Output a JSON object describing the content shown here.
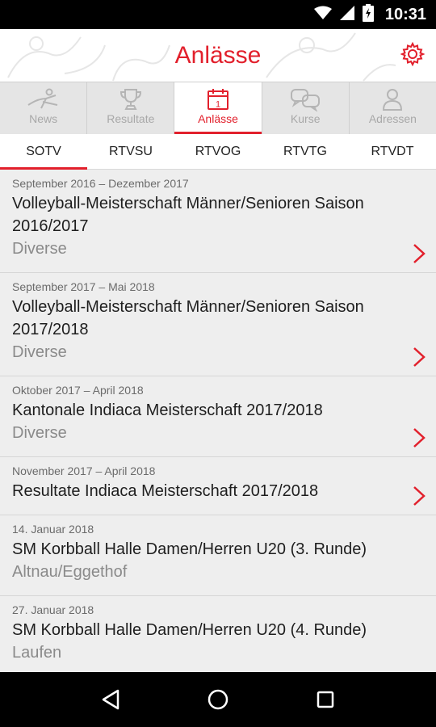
{
  "status_bar": {
    "time": "10:31",
    "icons": [
      "wifi-icon",
      "signal-icon",
      "battery-icon"
    ]
  },
  "app_bar": {
    "title": "Anlässe",
    "settings_icon": "gear-icon"
  },
  "top_tabs": [
    {
      "label": "News",
      "icon": "athlete-icon",
      "active": false
    },
    {
      "label": "Resultate",
      "icon": "trophy-icon",
      "active": false
    },
    {
      "label": "Anlässe",
      "icon": "calendar-icon",
      "active": true
    },
    {
      "label": "Kurse",
      "icon": "chat-icon",
      "active": false
    },
    {
      "label": "Adressen",
      "icon": "person-icon",
      "active": false
    }
  ],
  "calendar_day": "1",
  "sub_tabs": [
    {
      "label": "SOTV",
      "active": true
    },
    {
      "label": "RTVSU",
      "active": false
    },
    {
      "label": "RTVOG",
      "active": false
    },
    {
      "label": "RTVTG",
      "active": false
    },
    {
      "label": "RTVDT",
      "active": false
    }
  ],
  "events": [
    {
      "date": "September 2016 – Dezember 2017",
      "title": "Volleyball-Meisterschaft Männer/Senioren Saison 2016/2017",
      "location": "Diverse",
      "has_link": true
    },
    {
      "date": "September 2017 – Mai 2018",
      "title": "Volleyball-Meisterschaft Männer/Senioren Saison 2017/2018",
      "location": "Diverse",
      "has_link": true
    },
    {
      "date": "Oktober 2017 – April 2018",
      "title": "Kantonale Indiaca Meisterschaft 2017/2018",
      "location": "Diverse",
      "has_link": true
    },
    {
      "date": "November 2017 – April 2018",
      "title": "Resultate Indiaca Meisterschaft 2017/2018",
      "location": "",
      "has_link": true
    },
    {
      "date": "14. Januar 2018",
      "title": "SM Korbball Halle Damen/Herren U20 (3. Runde)",
      "location": "Altnau/Eggethof",
      "has_link": false
    },
    {
      "date": "27. Januar 2018",
      "title": "SM Korbball Halle Damen/Herren U20 (4. Runde)",
      "location": "Laufen",
      "has_link": false
    }
  ],
  "nav_bar": {
    "buttons": [
      "back-icon",
      "home-icon",
      "recents-icon"
    ]
  },
  "colors": {
    "accent": "#e2202c",
    "tab_bg": "#e5e5e5",
    "list_bg": "#eeeeee"
  }
}
